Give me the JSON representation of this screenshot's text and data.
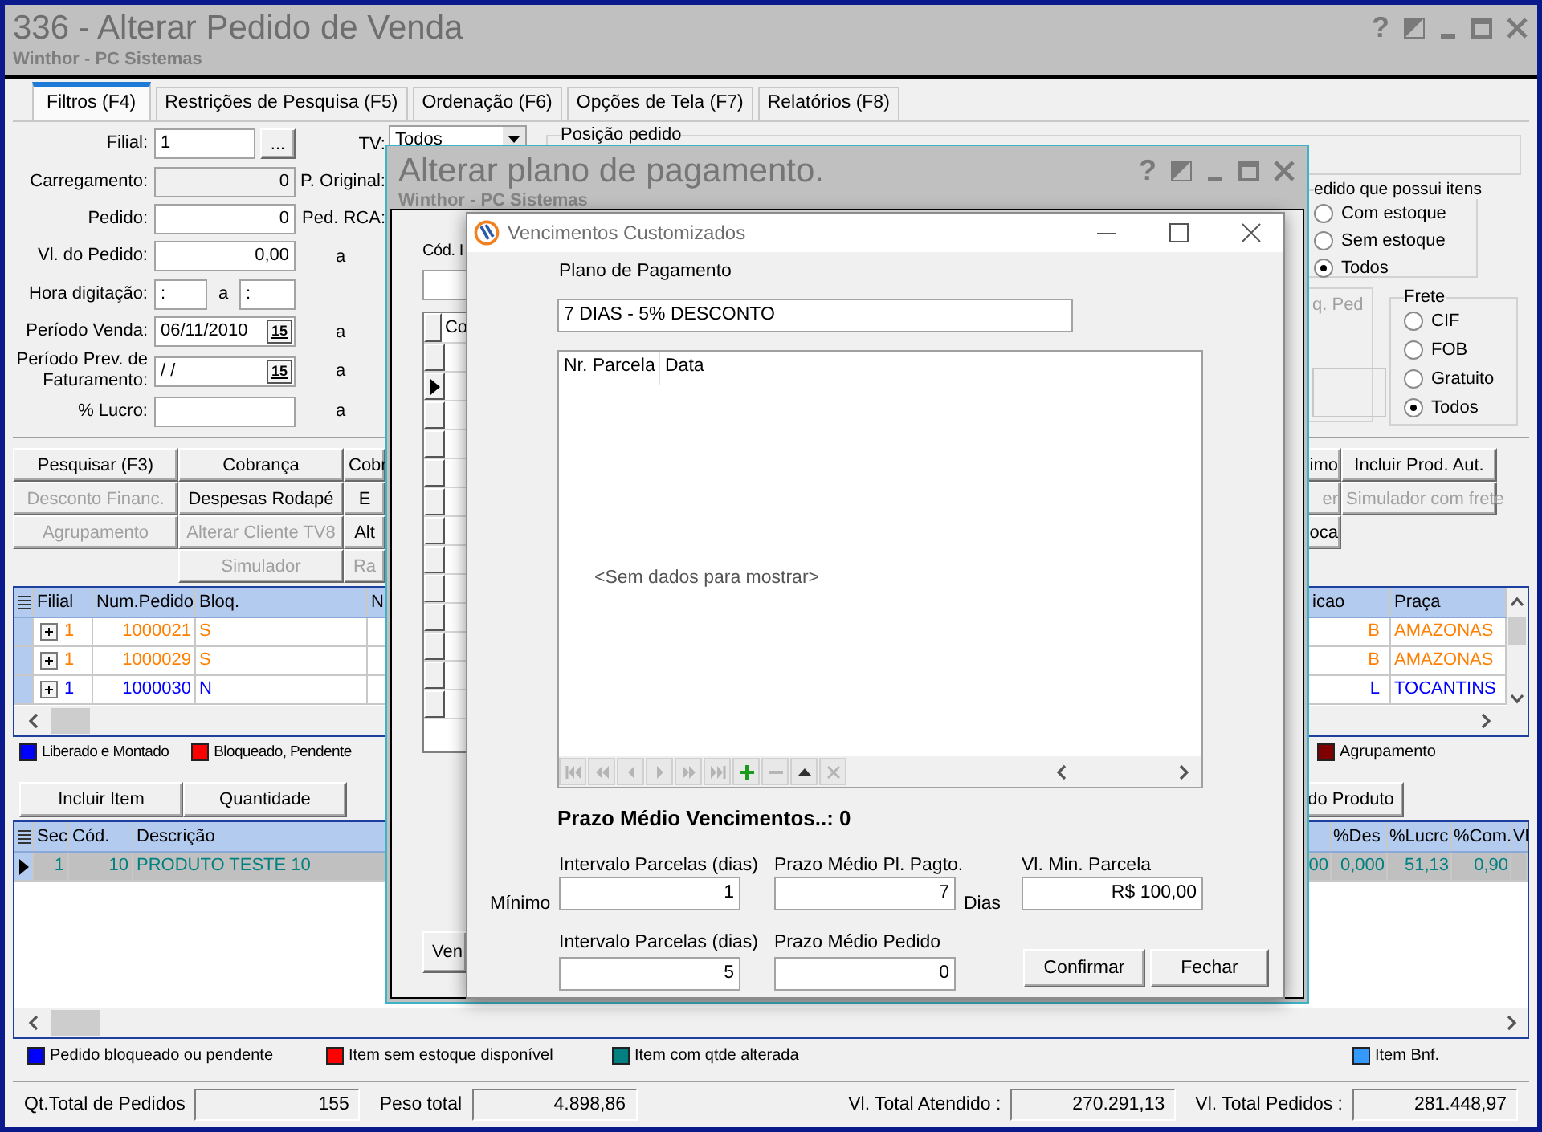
{
  "window": {
    "title": "336 - Alterar Pedido de Venda",
    "subtitle": "Winthor - PC Sistemas",
    "help_button": "?"
  },
  "tabs": [
    {
      "label": "Filtros (F4)",
      "selected": true
    },
    {
      "label": "Restrições de Pesquisa (F5)",
      "selected": false
    },
    {
      "label": "Ordenação (F6)",
      "selected": false
    },
    {
      "label": "Opções de Tela (F7)",
      "selected": false
    },
    {
      "label": "Relatórios (F8)",
      "selected": false
    }
  ],
  "filters": [
    {
      "label": "Filial:",
      "kind": "lookup",
      "value": "1",
      "button": "...",
      "side_label": "TV:"
    },
    {
      "label": "Carregamento:",
      "kind": "readonly",
      "value": "0",
      "side_label": "P. Original:"
    },
    {
      "label": "Pedido:",
      "kind": "number",
      "value": "0",
      "side_label": "Ped. RCA:"
    },
    {
      "label": "Vl. do Pedido:",
      "kind": "number",
      "value": "0,00",
      "to": "a"
    },
    {
      "label": "Hora digitação:",
      "kind": "time",
      "value": ":",
      "between": "a",
      "value2": ":"
    },
    {
      "label": "Período Venda:",
      "kind": "date",
      "value": "06/11/2010",
      "calendar": "15",
      "to": "a"
    },
    {
      "label": "Período Prev. de Faturamento:",
      "kind": "date",
      "value": "/ /",
      "calendar": "15",
      "to": "a"
    },
    {
      "label": "% Lucro:",
      "kind": "number",
      "to": "a"
    }
  ],
  "tv_select": {
    "value": "Todos"
  },
  "position_group": {
    "title": "Posição pedido"
  },
  "stock_group": {
    "title": "edido que possui itens",
    "options": [
      {
        "label": "Com estoque",
        "selected": false
      },
      {
        "label": "Sem estoque",
        "selected": false
      },
      {
        "label": "Todos",
        "selected": true
      }
    ]
  },
  "blocked_panel": {
    "title": "q. Ped"
  },
  "freight_group": {
    "title": "Frete",
    "options": [
      {
        "label": "CIF",
        "selected": false
      },
      {
        "label": "FOB",
        "selected": false
      },
      {
        "label": "Gratuito",
        "selected": false
      },
      {
        "label": "Todos",
        "selected": true
      }
    ]
  },
  "actions_left": [
    [
      {
        "label": "Pesquisar (F3)",
        "disabled": false
      },
      {
        "label": "Desconto Financ.",
        "disabled": true
      },
      {
        "label": "Agrupamento",
        "disabled": true
      }
    ],
    [
      {
        "label": "Cobrança",
        "disabled": false
      },
      {
        "label": "Despesas Rodapé",
        "disabled": false
      },
      {
        "label": "Alterar Cliente TV8",
        "disabled": true
      },
      {
        "label": "Simulador",
        "disabled": true
      }
    ],
    [
      {
        "label": "Cobr",
        "disabled": false
      },
      {
        "label": "E",
        "disabled": false
      },
      {
        "label": "Alt",
        "disabled": false
      },
      {
        "label": "Ra",
        "disabled": true
      }
    ]
  ],
  "actions_right": [
    [
      {
        "label": "imo",
        "disabled": false
      },
      {
        "label": "er",
        "disabled": true
      },
      {
        "label": "oca",
        "disabled": false
      }
    ],
    [
      {
        "label": "Incluir Prod. Aut.",
        "disabled": false
      },
      {
        "label": "Simulador com frete",
        "disabled": true
      }
    ]
  ],
  "orders": {
    "columns": [
      "Filial",
      "Num.Pedido",
      "Bloq.",
      "N",
      "icao",
      "Praça"
    ],
    "rows": [
      {
        "color": "#ff8000",
        "cells": [
          "1",
          "1000021",
          "S",
          "B",
          "AMAZONAS"
        ]
      },
      {
        "color": "#ff8000",
        "cells": [
          "1",
          "1000029",
          "S",
          "B",
          "AMAZONAS"
        ]
      },
      {
        "color": "#0000ff",
        "cells": [
          "1",
          "1000030",
          "N",
          "L",
          "TOCANTINS"
        ]
      }
    ]
  },
  "legend": [
    {
      "label": "Liberado e Montado",
      "color": "#0000ff"
    },
    {
      "label": "Bloqueado, Pendente",
      "color": "#ff0000"
    },
    {
      "label": "Agrupamento",
      "color": "#800000"
    }
  ],
  "item_actions": [
    "Incluir Item",
    "Quantidade",
    "do Produto"
  ],
  "items": {
    "columns": [
      "Sec",
      "Cód.",
      "Descrição",
      "",
      "%Des",
      "%Lucrc",
      "%Com.",
      "Vl"
    ],
    "rows": [
      {
        "selected": true,
        "color": "#008080",
        "cells": [
          "1",
          "10",
          "PRODUTO TESTE 10",
          "00",
          "0,000",
          "51,13",
          "0,90"
        ]
      }
    ]
  },
  "item_legend": [
    {
      "label": "Pedido bloqueado ou pendente",
      "color": "#0000ff"
    },
    {
      "label": "Item sem estoque disponível",
      "color": "#ff0000"
    },
    {
      "label": "Item com qtde alterada",
      "color": "#008080"
    },
    {
      "label": "Item Bnf.",
      "color": "#3399ff"
    }
  ],
  "totals": [
    {
      "label": "Qt.Total de Pedidos",
      "value": "155"
    },
    {
      "label": "Peso total",
      "value": "4.898,86"
    },
    {
      "label": "Vl. Total Atendido :",
      "value": "270.291,13"
    },
    {
      "label": "Vl. Total Pedidos :",
      "value": "281.448,97"
    }
  ],
  "plan_dialog": {
    "title": "Alterar plano de pagamento.",
    "subtitle": "Winthor - PC Sistemas",
    "help_button": "?",
    "code_label": "Cód. I",
    "grid_header": "Co",
    "rows": [
      {
        "selected": false
      },
      {
        "selected": true
      },
      {
        "selected": false
      },
      {
        "selected": false
      },
      {
        "selected": false
      },
      {
        "selected": false
      },
      {
        "selected": false
      },
      {
        "selected": false
      },
      {
        "selected": false
      },
      {
        "selected": false
      },
      {
        "selected": false
      },
      {
        "selected": false
      },
      {
        "selected": false
      }
    ],
    "button": "Ven"
  },
  "venc_dialog": {
    "title": "Vencimentos Customizados",
    "plan_label": "Plano de Pagamento",
    "plan_value": "7 DIAS - 5% DESCONTO",
    "grid": {
      "columns": [
        "Nr. Parcela",
        "Data"
      ],
      "empty_text": "<Sem dados para mostrar>"
    },
    "navigator": [
      {
        "kind": "first",
        "disabled": true
      },
      {
        "kind": "prior_page",
        "disabled": true
      },
      {
        "kind": "prior",
        "disabled": true
      },
      {
        "kind": "next",
        "disabled": true
      },
      {
        "kind": "next_page",
        "disabled": true
      },
      {
        "kind": "last",
        "disabled": true
      },
      {
        "kind": "append",
        "disabled": false
      },
      {
        "kind": "delete",
        "disabled": true
      },
      {
        "kind": "edit",
        "disabled": false
      },
      {
        "kind": "cancel",
        "disabled": true
      }
    ],
    "average": "Prazo Médio Vencimentos..: 0",
    "rows": [
      {
        "label": "Mínimo",
        "fields": [
          {
            "label": "Intervalo Parcelas (dias)",
            "value": "1"
          },
          {
            "label": "Prazo Médio Pl. Pagto.",
            "value": "7",
            "unit": "Dias"
          },
          {
            "label": "Vl. Min. Parcela",
            "value": "R$ 100,00"
          }
        ]
      },
      {
        "fields": [
          {
            "label": "Intervalo Parcelas (dias)",
            "value": "5"
          },
          {
            "label": "Prazo Médio Pedido",
            "value": "0"
          }
        ]
      }
    ],
    "buttons": [
      "Confirmar",
      "Fechar"
    ]
  }
}
